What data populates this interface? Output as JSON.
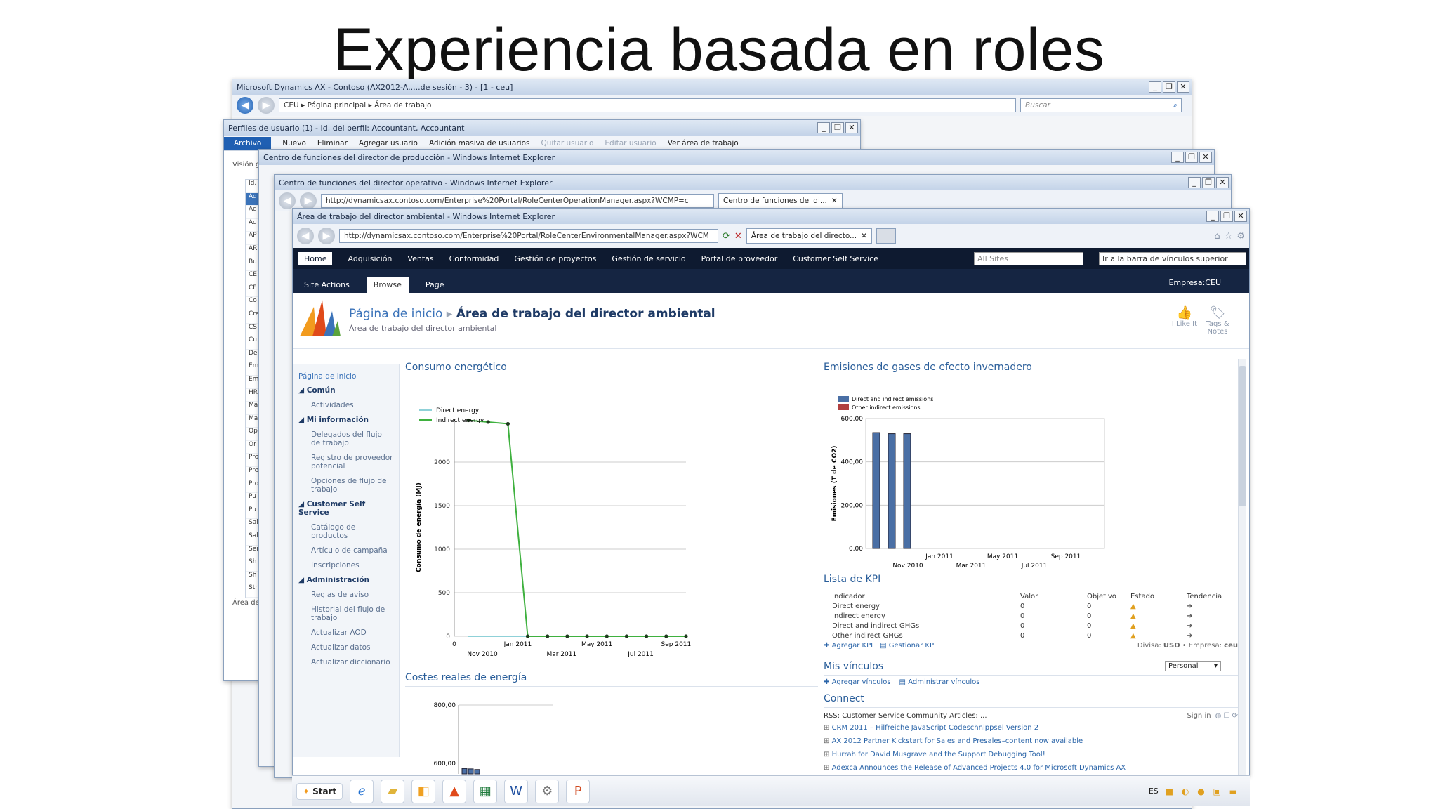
{
  "slide_title": "Experiencia basada en roles",
  "ax_window": {
    "title": "Microsoft Dynamics AX - Contoso (AX2012-A.....de sesión - 3) - [1 - ceu]",
    "breadcrumb": [
      "CEU",
      "Página principal",
      "Área de trabajo"
    ],
    "search_placeholder": "Buscar"
  },
  "users_window": {
    "title": "Perfiles de usuario (1) - Id. del perfil: Accountant, Accountant",
    "menu_file": "Archivo",
    "toolbar": [
      "Nuevo",
      "Eliminar",
      "Agregar usuario",
      "Adición masiva de usuarios",
      "Quitar usuario",
      "Editar usuario",
      "Ver área de trabajo"
    ],
    "view_label": "Visión g",
    "list": [
      "Id.",
      "Ad",
      "Ac",
      "Ac",
      "AP",
      "AR",
      "Bu",
      "CE",
      "CF",
      "Co",
      "Cre",
      "CS",
      "Cu",
      "De",
      "Em",
      "Em",
      "HR",
      "Ma",
      "Ma",
      "Op",
      "Or",
      "Pro",
      "Pro",
      "Pro",
      "Pu",
      "Pu",
      "Sal",
      "Sal",
      "Ser",
      "Sh",
      "Sh",
      "Str"
    ],
    "footer": "Área de"
  },
  "ie_window_1": {
    "title": "Centro de funciones del director de producción - Windows Internet Explorer"
  },
  "ie_window_2": {
    "title": "Centro de funciones del director operativo - Windows Internet Explorer",
    "url": "http://dynamicsax.contoso.com/Enterprise%20Portal/RoleCenterOperationManager.aspx?WCMP=c",
    "tab": "Centro de funciones del di..."
  },
  "ie_window_3": {
    "title": "Área de trabajo del director ambiental - Windows Internet Explorer",
    "url": "http://dynamicsax.contoso.com/Enterprise%20Portal/RoleCenterEnvironmentalManager.aspx?WCM",
    "tab": "Área de trabajo del directo..."
  },
  "sp": {
    "top_nav": [
      "Home",
      "Adquisición",
      "Ventas",
      "Conformidad",
      "Gestión de proyectos",
      "Gestión de servicio",
      "Portal de proveedor",
      "Customer Self Service"
    ],
    "site_scope": "All Sites",
    "topnav_search": "Ir a la barra de vínculos superior",
    "ribbon_tabs": [
      "Site Actions",
      "Browse",
      "Page"
    ],
    "company": "Empresa:CEU",
    "breadcrumb_home": "Página de inicio",
    "page_title": "Área de trabajo del director ambiental",
    "page_subtitle": "Área de trabajo del director ambiental",
    "like_it": "I Like It",
    "tags_notes": "Tags & Notes",
    "quicklaunch": [
      {
        "type": "home",
        "label": "Página de inicio"
      },
      {
        "type": "hdr",
        "label": "Común"
      },
      {
        "type": "sub",
        "label": "Actividades"
      },
      {
        "type": "hdr",
        "label": "Mi información"
      },
      {
        "type": "sub",
        "label": "Delegados del flujo de trabajo"
      },
      {
        "type": "sub",
        "label": "Registro de proveedor potencial"
      },
      {
        "type": "sub",
        "label": "Opciones de flujo de trabajo"
      },
      {
        "type": "hdr",
        "label": "Customer Self Service"
      },
      {
        "type": "sub",
        "label": "Catálogo de productos"
      },
      {
        "type": "sub",
        "label": "Artículo de campaña"
      },
      {
        "type": "sub",
        "label": "Inscripciones"
      },
      {
        "type": "hdr",
        "label": "Administración"
      },
      {
        "type": "sub",
        "label": "Reglas de aviso"
      },
      {
        "type": "sub",
        "label": "Historial del flujo de trabajo"
      },
      {
        "type": "sub",
        "label": "Actualizar AOD"
      },
      {
        "type": "sub",
        "label": "Actualizar datos"
      },
      {
        "type": "sub",
        "label": "Actualizar diccionario"
      }
    ],
    "energy_title": "Consumo energético",
    "emissions_title": "Emisiones de gases de efecto invernadero",
    "costs_title": "Costes reales de energía",
    "kpi_title": "Lista de KPI",
    "kpi_headers": [
      "Indicador",
      "Valor",
      "Objetivo",
      "Estado",
      "Tendencia"
    ],
    "kpi_rows": [
      [
        "Direct energy",
        "0",
        "0"
      ],
      [
        "Indirect energy",
        "0",
        "0"
      ],
      [
        "Direct and indirect GHGs",
        "0",
        "0"
      ],
      [
        "Other indirect GHGs",
        "0",
        "0"
      ]
    ],
    "kpi_add": "Agregar KPI",
    "kpi_manage": "Gestionar KPI",
    "currency_label": "Divisa:",
    "currency": "USD",
    "company_label": "Empresa:",
    "company_code": "ceu",
    "links_title": "Mis vínculos",
    "links_add": "Agregar vínculos",
    "links_manage": "Administrar vínculos",
    "links_select": "Personal",
    "connect_title": "Connect",
    "rss_label": "RSS: Customer Service Community Articles: ...",
    "sign_in": "Sign in",
    "rss_items": [
      "CRM 2011 – Hilfreiche JavaScript Codeschnippsel Version 2",
      "AX 2012 Partner Kickstart for Sales and Presales–content now available",
      "Hurrah for David Musgrave and the Support Debugging Tool!",
      "Adexca Announces the Release of Advanced Projects 4.0 for Microsoft Dynamics AX"
    ]
  },
  "taskbar": {
    "start": "Start",
    "lang": "ES"
  },
  "chart_data": [
    {
      "type": "line",
      "title": "Consumo energético",
      "ylabel": "Consumo de energía (MJ)",
      "ylim": [
        0,
        2500
      ],
      "yticks": [
        0,
        500,
        1000,
        1500,
        2000
      ],
      "xtick_labels_top": [
        "0",
        "Jan 2011",
        "May 2011",
        "Sep 2011"
      ],
      "xtick_labels_bottom": [
        "Nov 2010",
        "Mar 2011",
        "Jul 2011"
      ],
      "legend": "top-left",
      "series": [
        {
          "name": "Direct energy",
          "color": "#8fd1d8",
          "values": [
            0,
            0,
            0,
            0,
            0,
            0,
            0,
            0,
            0,
            0,
            0,
            0
          ]
        },
        {
          "name": "Indirect energy",
          "color": "#3fb13f",
          "values": [
            2480,
            2460,
            2440,
            0,
            0,
            0,
            0,
            0,
            0,
            0,
            0,
            0
          ]
        }
      ]
    },
    {
      "type": "bar",
      "title": "Emisiones de gases de efecto invernadero",
      "ylabel": "Emisiones (T de CO2)",
      "ylim": [
        0,
        600
      ],
      "yticks": [
        "0,00",
        "200,00",
        "400,00",
        "600,00"
      ],
      "xtick_labels_top": [
        "Jan 2011",
        "May 2011",
        "Sep 2011"
      ],
      "xtick_labels_bottom": [
        "Nov 2010",
        "Mar 2011",
        "Jul 2011"
      ],
      "legend": "top-left",
      "series": [
        {
          "name": "Direct and indirect emissions",
          "color": "#4a6fa5",
          "values": [
            535,
            530,
            530
          ]
        },
        {
          "name": "Other indirect emissions",
          "color": "#b04040",
          "values": [
            0,
            0,
            0
          ]
        }
      ]
    },
    {
      "type": "bar",
      "title": "Costes reales de energía",
      "ylim": [
        600,
        800
      ],
      "yticks": [
        "600,00",
        "800,00"
      ],
      "series": [
        {
          "color": "#4a6fa5",
          "values": [
            620,
            618,
            615
          ]
        }
      ]
    }
  ]
}
